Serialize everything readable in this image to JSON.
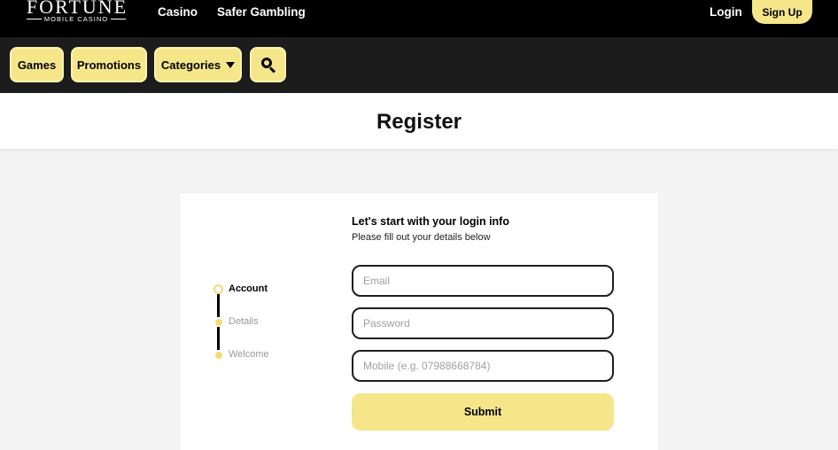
{
  "header": {
    "logo": {
      "brand": "FORTUNE",
      "sub": "MOBILE CASINO"
    },
    "nav": [
      {
        "label": "Casino"
      },
      {
        "label": "Safer Gambling"
      }
    ],
    "login_label": "Login",
    "signup_label": "Sign Up"
  },
  "navbar": {
    "items": [
      {
        "label": "Games"
      },
      {
        "label": "Promotions"
      },
      {
        "label": "Categories"
      }
    ],
    "search_icon": "search-icon"
  },
  "page": {
    "title": "Register"
  },
  "steps": [
    {
      "label": "Account",
      "state": "current"
    },
    {
      "label": "Details",
      "state": "pending"
    },
    {
      "label": "Welcome",
      "state": "pending"
    }
  ],
  "form": {
    "heading": "Let's start with your login info",
    "subheading": "Please fill out your details below",
    "email": {
      "value": "",
      "placeholder": "Email"
    },
    "password": {
      "value": "",
      "placeholder": "Password"
    },
    "mobile": {
      "value": "",
      "placeholder": "Mobile (e.g. 07988668784)"
    },
    "submit_label": "Submit"
  },
  "colors": {
    "accent": "#f5e68a",
    "step_dot": "#f0dc78",
    "topbar": "#000000",
    "navbar": "#1c1c1c"
  }
}
